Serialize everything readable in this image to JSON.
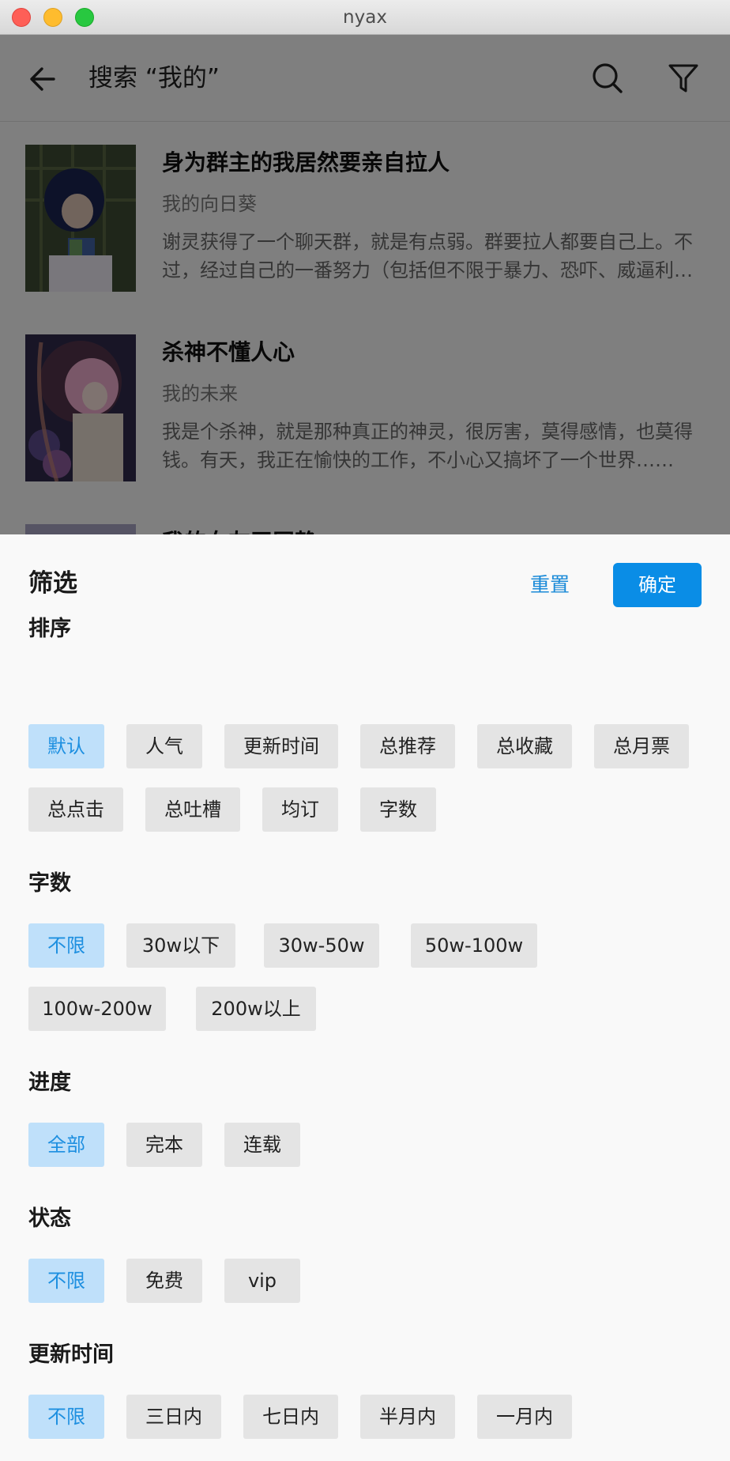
{
  "window": {
    "title": "nyax"
  },
  "header": {
    "title": "搜索 “我的”"
  },
  "results": [
    {
      "title": "身为群主的我居然要亲自拉人",
      "author": "我的向日葵",
      "desc": "谢灵获得了一个聊天群，就是有点弱。群要拉人都要自己上。不过，经过自己的一番努力（包括但不限于暴力、恐吓、威逼利诱等手段），群终于变得热闹起来……"
    },
    {
      "title": "杀神不懂人心",
      "author": "我的未来",
      "desc": "我是个杀神，就是那种真正的神灵，很厉害，莫得感情，也莫得钱。有天，我正在愉快的工作，不小心又搞坏了一个世界……"
    },
    {
      "title": "我的女友平冈静",
      "author": "",
      "desc": ""
    }
  ],
  "filter": {
    "title": "筛选",
    "reset_label": "重置",
    "confirm_label": "确定",
    "sections": [
      {
        "label": "排序",
        "options": [
          "默认",
          "人气",
          "更新时间",
          "总推荐",
          "总收藏",
          "总月票",
          "总点击",
          "总吐槽",
          "均订",
          "字数"
        ],
        "selected": "默认"
      },
      {
        "label": "字数",
        "options": [
          "不限",
          "30w以下",
          "30w-50w",
          "50w-100w",
          "100w-200w",
          "200w以上"
        ],
        "selected": "不限"
      },
      {
        "label": "进度",
        "options": [
          "全部",
          "完本",
          "连载"
        ],
        "selected": "全部"
      },
      {
        "label": "状态",
        "options": [
          "不限",
          "免费",
          "vip"
        ],
        "selected": "不限"
      },
      {
        "label": "更新时间",
        "options": [
          "不限",
          "三日内",
          "七日内",
          "半月内",
          "一月内"
        ],
        "selected": "不限"
      }
    ]
  },
  "colors": {
    "accent": "#0a8de6",
    "chip_selected_bg": "#bfe0fa",
    "chip_selected_text": "#1d8fe0",
    "chip_bg": "#e4e4e4"
  }
}
